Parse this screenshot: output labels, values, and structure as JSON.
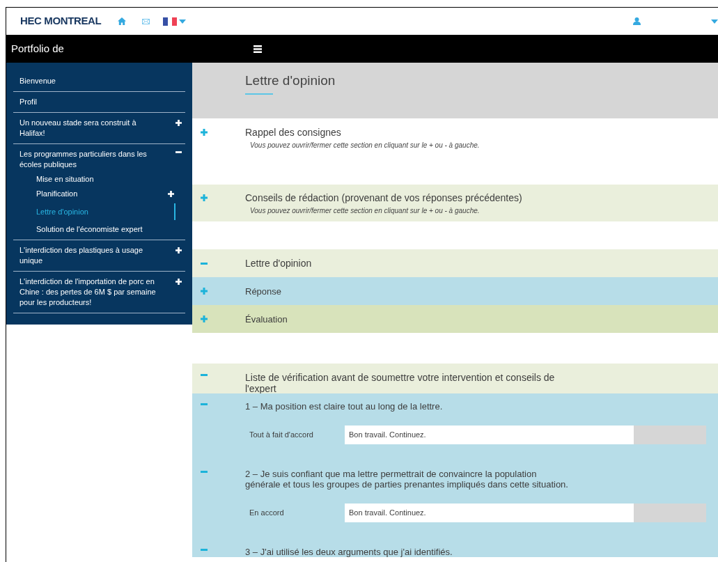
{
  "header": {
    "logo": "HEC MONTREAL"
  },
  "topbar": {
    "title": "Portfolio de"
  },
  "sidebar": {
    "items": [
      {
        "label": "Bienvenue",
        "selected": false
      },
      {
        "label": "Profil",
        "selected": false
      },
      {
        "label": "Un nouveau stade sera construit à Halifax!",
        "selected": false,
        "expanded": false
      },
      {
        "label": "Les programmes particuliers dans les écoles publiques",
        "selected": false,
        "expanded": true,
        "children": [
          {
            "label": "Mise en situation",
            "selected": false
          },
          {
            "label": "Planification",
            "selected": false,
            "expanded": false
          },
          {
            "label": "Lettre d'opinion",
            "selected": true
          },
          {
            "label": "Solution de l'économiste expert",
            "selected": false
          }
        ]
      },
      {
        "label": "L'interdiction des plastiques à usage unique",
        "selected": false,
        "expanded": false
      },
      {
        "label": "L'interdiction de l'importation de porc en Chine : des pertes de 6M $ par semaine pour les producteurs!",
        "selected": false,
        "expanded": false
      }
    ]
  },
  "page_title": "Lettre d'opinion",
  "sections": [
    {
      "kind": "instructions",
      "title": "Rappel des consignes",
      "note": "Vous pouvez ouvrir/fermer cette section en cliquant sur le + ou - à gauche.",
      "expanded": false
    },
    {
      "kind": "advice",
      "title": "Conseils de rédaction (provenant de vos réponses précédentes)",
      "note": "Vous pouvez ouvrir/fermer cette section en cliquant sur le + ou - à gauche.",
      "expanded": false
    },
    {
      "kind": "part",
      "title": "Lettre d'opinion",
      "expanded": true
    },
    {
      "kind": "subpart",
      "title": "Réponse",
      "expanded": false
    },
    {
      "kind": "evaluation",
      "title": "Évaluation",
      "expanded": false
    },
    {
      "kind": "checklist",
      "title": "Liste de vérification avant de soumettre votre intervention et conseils de l'expert",
      "expanded": true
    },
    {
      "kind": "criterion",
      "title": "1 – Ma position est claire tout au long de la lettre.",
      "expanded": true,
      "rating": "Tout à fait d'accord",
      "feedback": "Bon travail. Continuez."
    },
    {
      "kind": "criterion",
      "title": "2 – Je suis confiant que ma lettre permettrait de convaincre la population générale et tous les groupes de parties prenantes impliqués dans cette situation.",
      "expanded": true,
      "rating": "En accord",
      "feedback": "Bon travail. Continuez."
    },
    {
      "kind": "criterion",
      "title": "3 – J'ai utilisé les deux arguments que j'ai identifiés.",
      "expanded": true
    }
  ]
}
